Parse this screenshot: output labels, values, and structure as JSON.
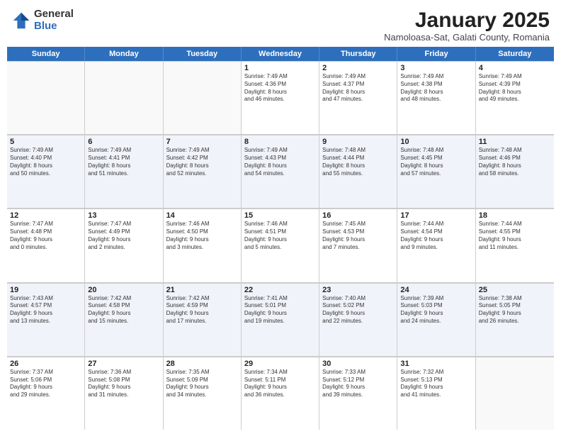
{
  "logo": {
    "general": "General",
    "blue": "Blue"
  },
  "title": "January 2025",
  "subtitle": "Namoloasa-Sat, Galati County, Romania",
  "dayHeaders": [
    "Sunday",
    "Monday",
    "Tuesday",
    "Wednesday",
    "Thursday",
    "Friday",
    "Saturday"
  ],
  "weeks": [
    [
      {
        "num": "",
        "info": ""
      },
      {
        "num": "",
        "info": ""
      },
      {
        "num": "",
        "info": ""
      },
      {
        "num": "1",
        "info": "Sunrise: 7:49 AM\nSunset: 4:36 PM\nDaylight: 8 hours\nand 46 minutes."
      },
      {
        "num": "2",
        "info": "Sunrise: 7:49 AM\nSunset: 4:37 PM\nDaylight: 8 hours\nand 47 minutes."
      },
      {
        "num": "3",
        "info": "Sunrise: 7:49 AM\nSunset: 4:38 PM\nDaylight: 8 hours\nand 48 minutes."
      },
      {
        "num": "4",
        "info": "Sunrise: 7:49 AM\nSunset: 4:39 PM\nDaylight: 8 hours\nand 49 minutes."
      }
    ],
    [
      {
        "num": "5",
        "info": "Sunrise: 7:49 AM\nSunset: 4:40 PM\nDaylight: 8 hours\nand 50 minutes."
      },
      {
        "num": "6",
        "info": "Sunrise: 7:49 AM\nSunset: 4:41 PM\nDaylight: 8 hours\nand 51 minutes."
      },
      {
        "num": "7",
        "info": "Sunrise: 7:49 AM\nSunset: 4:42 PM\nDaylight: 8 hours\nand 52 minutes."
      },
      {
        "num": "8",
        "info": "Sunrise: 7:49 AM\nSunset: 4:43 PM\nDaylight: 8 hours\nand 54 minutes."
      },
      {
        "num": "9",
        "info": "Sunrise: 7:48 AM\nSunset: 4:44 PM\nDaylight: 8 hours\nand 55 minutes."
      },
      {
        "num": "10",
        "info": "Sunrise: 7:48 AM\nSunset: 4:45 PM\nDaylight: 8 hours\nand 57 minutes."
      },
      {
        "num": "11",
        "info": "Sunrise: 7:48 AM\nSunset: 4:46 PM\nDaylight: 8 hours\nand 58 minutes."
      }
    ],
    [
      {
        "num": "12",
        "info": "Sunrise: 7:47 AM\nSunset: 4:48 PM\nDaylight: 9 hours\nand 0 minutes."
      },
      {
        "num": "13",
        "info": "Sunrise: 7:47 AM\nSunset: 4:49 PM\nDaylight: 9 hours\nand 2 minutes."
      },
      {
        "num": "14",
        "info": "Sunrise: 7:46 AM\nSunset: 4:50 PM\nDaylight: 9 hours\nand 3 minutes."
      },
      {
        "num": "15",
        "info": "Sunrise: 7:46 AM\nSunset: 4:51 PM\nDaylight: 9 hours\nand 5 minutes."
      },
      {
        "num": "16",
        "info": "Sunrise: 7:45 AM\nSunset: 4:53 PM\nDaylight: 9 hours\nand 7 minutes."
      },
      {
        "num": "17",
        "info": "Sunrise: 7:44 AM\nSunset: 4:54 PM\nDaylight: 9 hours\nand 9 minutes."
      },
      {
        "num": "18",
        "info": "Sunrise: 7:44 AM\nSunset: 4:55 PM\nDaylight: 9 hours\nand 11 minutes."
      }
    ],
    [
      {
        "num": "19",
        "info": "Sunrise: 7:43 AM\nSunset: 4:57 PM\nDaylight: 9 hours\nand 13 minutes."
      },
      {
        "num": "20",
        "info": "Sunrise: 7:42 AM\nSunset: 4:58 PM\nDaylight: 9 hours\nand 15 minutes."
      },
      {
        "num": "21",
        "info": "Sunrise: 7:42 AM\nSunset: 4:59 PM\nDaylight: 9 hours\nand 17 minutes."
      },
      {
        "num": "22",
        "info": "Sunrise: 7:41 AM\nSunset: 5:01 PM\nDaylight: 9 hours\nand 19 minutes."
      },
      {
        "num": "23",
        "info": "Sunrise: 7:40 AM\nSunset: 5:02 PM\nDaylight: 9 hours\nand 22 minutes."
      },
      {
        "num": "24",
        "info": "Sunrise: 7:39 AM\nSunset: 5:03 PM\nDaylight: 9 hours\nand 24 minutes."
      },
      {
        "num": "25",
        "info": "Sunrise: 7:38 AM\nSunset: 5:05 PM\nDaylight: 9 hours\nand 26 minutes."
      }
    ],
    [
      {
        "num": "26",
        "info": "Sunrise: 7:37 AM\nSunset: 5:06 PM\nDaylight: 9 hours\nand 29 minutes."
      },
      {
        "num": "27",
        "info": "Sunrise: 7:36 AM\nSunset: 5:08 PM\nDaylight: 9 hours\nand 31 minutes."
      },
      {
        "num": "28",
        "info": "Sunrise: 7:35 AM\nSunset: 5:09 PM\nDaylight: 9 hours\nand 34 minutes."
      },
      {
        "num": "29",
        "info": "Sunrise: 7:34 AM\nSunset: 5:11 PM\nDaylight: 9 hours\nand 36 minutes."
      },
      {
        "num": "30",
        "info": "Sunrise: 7:33 AM\nSunset: 5:12 PM\nDaylight: 9 hours\nand 39 minutes."
      },
      {
        "num": "31",
        "info": "Sunrise: 7:32 AM\nSunset: 5:13 PM\nDaylight: 9 hours\nand 41 minutes."
      },
      {
        "num": "",
        "info": ""
      }
    ]
  ]
}
